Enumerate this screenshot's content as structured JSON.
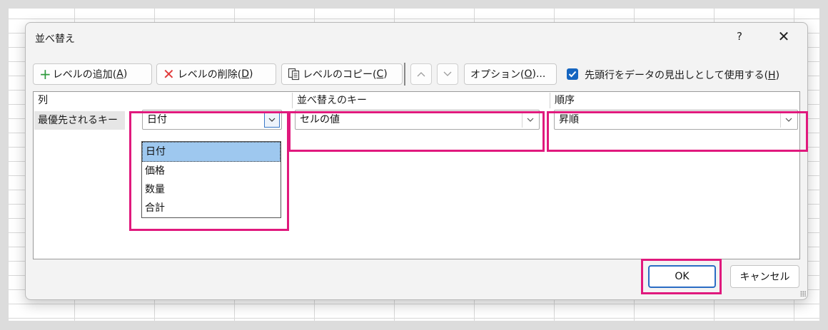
{
  "dialog": {
    "title": "並べ替え",
    "help": "?",
    "close": "✕"
  },
  "toolbar": {
    "add_level": {
      "label": "レベルの追加(",
      "key": "A",
      "suffix": ")"
    },
    "delete_level": {
      "label": "レベルの削除(",
      "key": "D",
      "suffix": ")"
    },
    "copy_level": {
      "label": "レベルのコピー(",
      "key": "C",
      "suffix": ")"
    },
    "options": {
      "label": "オプション(",
      "key": "O",
      "suffix": ")..."
    },
    "header_checkbox": {
      "checked": true,
      "label": "先頭行をデータの見出しとして使用する(",
      "key": "H",
      "suffix": ")"
    }
  },
  "grid": {
    "columns": [
      "列",
      "並べ替えのキー",
      "順序"
    ],
    "row": {
      "label": "最優先されるキー",
      "column_value": "日付",
      "key_value": "セルの値",
      "order_value": "昇順"
    },
    "column_options": [
      "日付",
      "価格",
      "数量",
      "合計"
    ],
    "column_selected": "日付"
  },
  "buttons": {
    "ok": "OK",
    "cancel": "キャンセル"
  },
  "colors": {
    "highlight": "#e0197d",
    "checkbox": "#1565c0",
    "ok_border": "#2a6cc4",
    "selected_option": "#9ec8ef"
  }
}
